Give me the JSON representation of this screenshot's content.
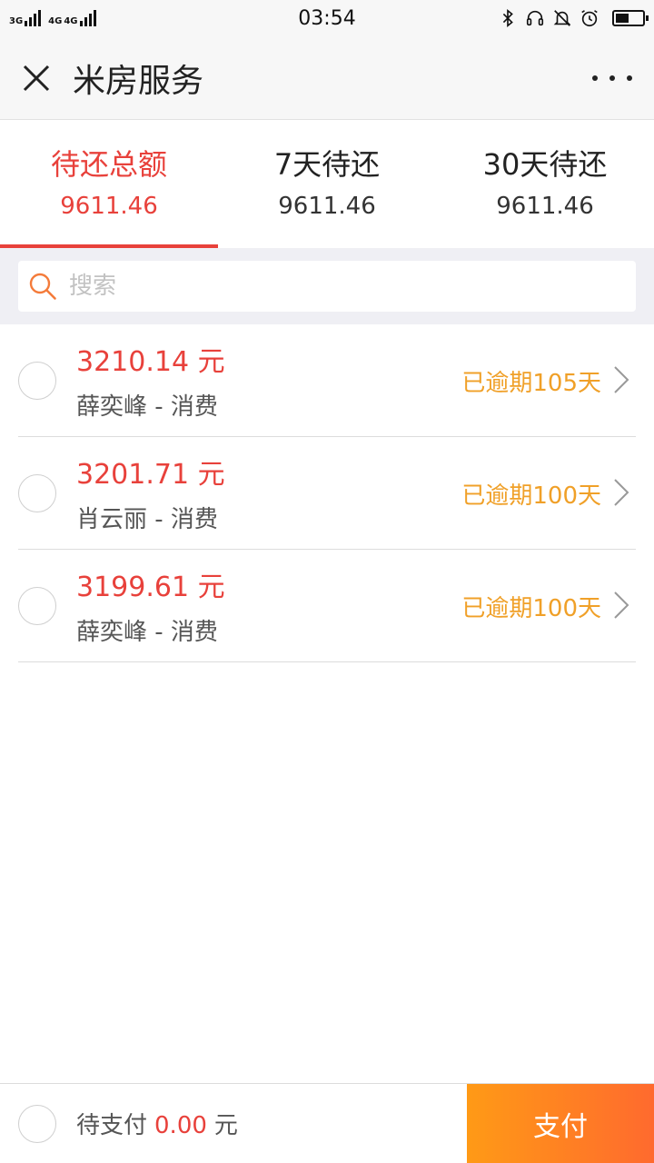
{
  "status_bar": {
    "network_1": "3G",
    "network_2": "4G",
    "network_3": "4G",
    "time": "03:54",
    "icons": [
      "bluetooth-icon",
      "headset-icon",
      "mute-bell-icon",
      "alarm-icon",
      "battery-icon"
    ],
    "battery_level": 0.5
  },
  "header": {
    "title": "米房服务"
  },
  "tabs": [
    {
      "label": "待还总额",
      "value": "9611.46",
      "active": true
    },
    {
      "label": "7天待还",
      "value": "9611.46",
      "active": false
    },
    {
      "label": "30天待还",
      "value": "9611.46",
      "active": false
    }
  ],
  "search": {
    "placeholder": "搜索"
  },
  "items": [
    {
      "amount": "3210.14 元",
      "desc": "薛奕峰 - 消费",
      "status": "已逾期105天"
    },
    {
      "amount": "3201.71 元",
      "desc": "肖云丽 - 消费",
      "status": "已逾期100天"
    },
    {
      "amount": "3199.61 元",
      "desc": "薛奕峰 - 消费",
      "status": "已逾期100天"
    }
  ],
  "bottom": {
    "pending_label": "待支付",
    "pending_amount": "0.00",
    "pending_unit": "元",
    "pay_label": "支付"
  },
  "colors": {
    "accent_red": "#e8413b",
    "overdue_orange": "#f0a028",
    "pay_gradient_start": "#ff9a16",
    "pay_gradient_end": "#ff6a2e"
  }
}
